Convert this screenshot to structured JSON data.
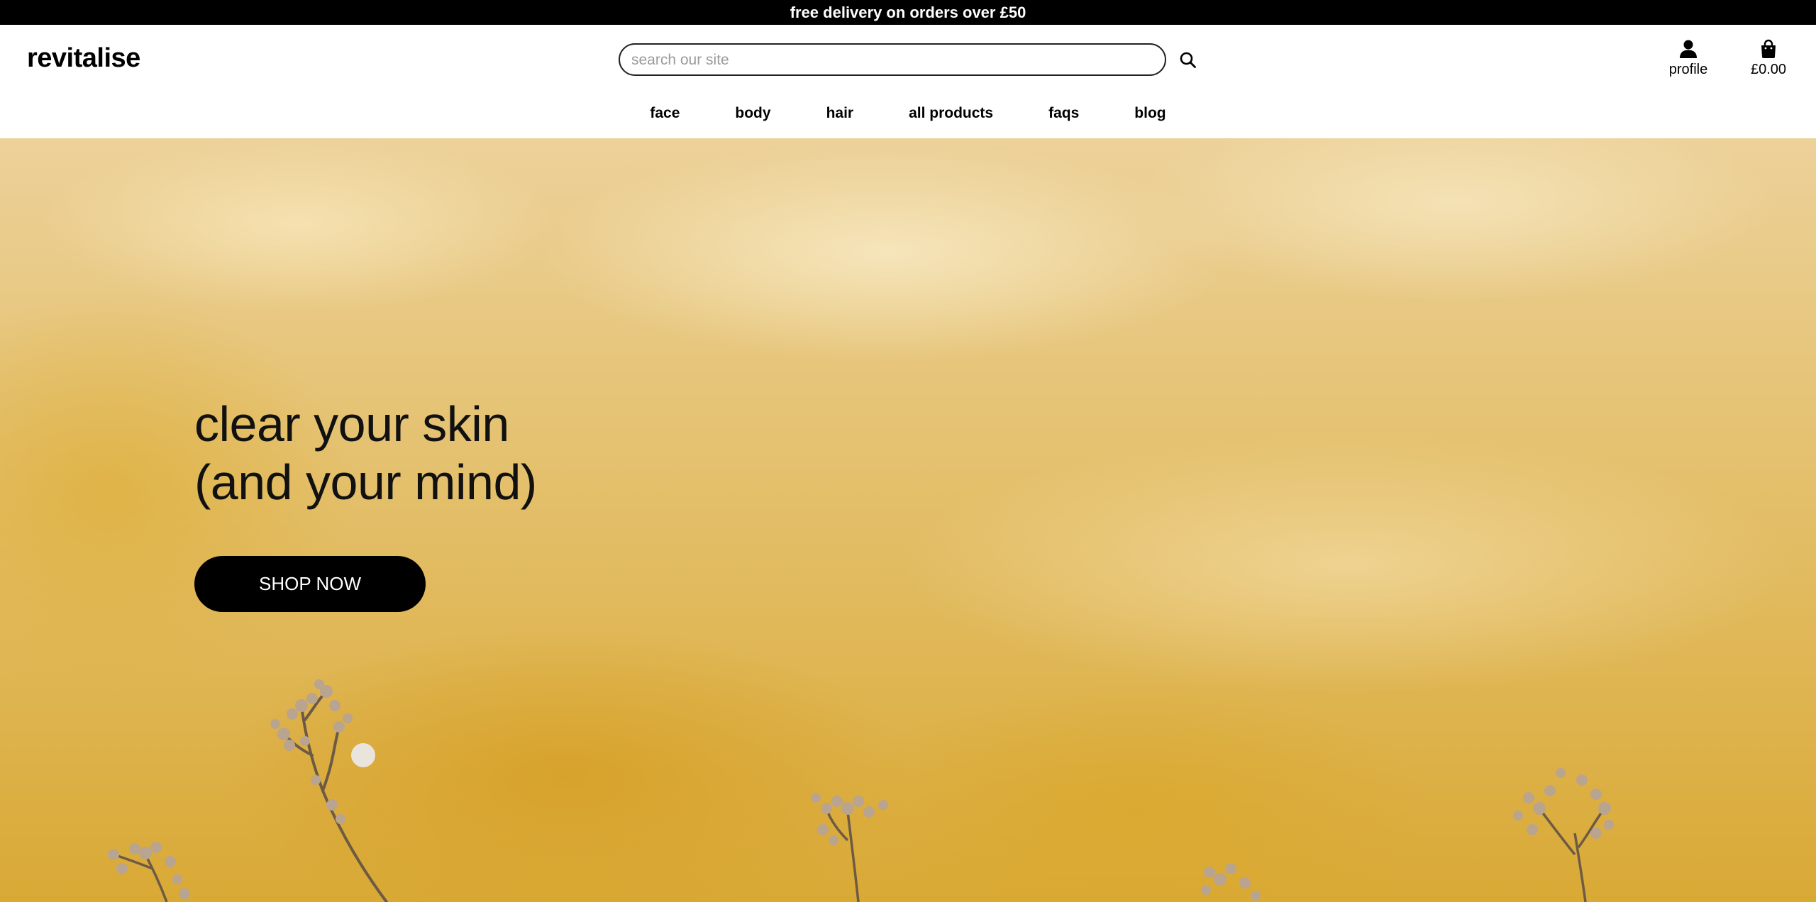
{
  "announcement": {
    "text": "free delivery on orders over £50"
  },
  "header": {
    "brand": "revitalise",
    "search": {
      "placeholder": "search our site",
      "value": "",
      "icon": "search-icon"
    },
    "profile": {
      "label": "profile",
      "icon": "person-icon"
    },
    "bag": {
      "total": "£0.00",
      "icon": "shopping-bag-icon"
    }
  },
  "nav": {
    "items": [
      {
        "label": "face"
      },
      {
        "label": "body"
      },
      {
        "label": "hair"
      },
      {
        "label": "all products"
      },
      {
        "label": "faqs"
      },
      {
        "label": "blog"
      }
    ]
  },
  "hero": {
    "title_line1": "clear your skin",
    "title_line2": "(and your mind)",
    "cta_label": "SHOP NOW",
    "background": "yellow painted wall with dried flowers"
  },
  "colors": {
    "announcement_bg": "#000000",
    "cta_bg": "#000000",
    "hero_yellow": "#e4c06c"
  }
}
